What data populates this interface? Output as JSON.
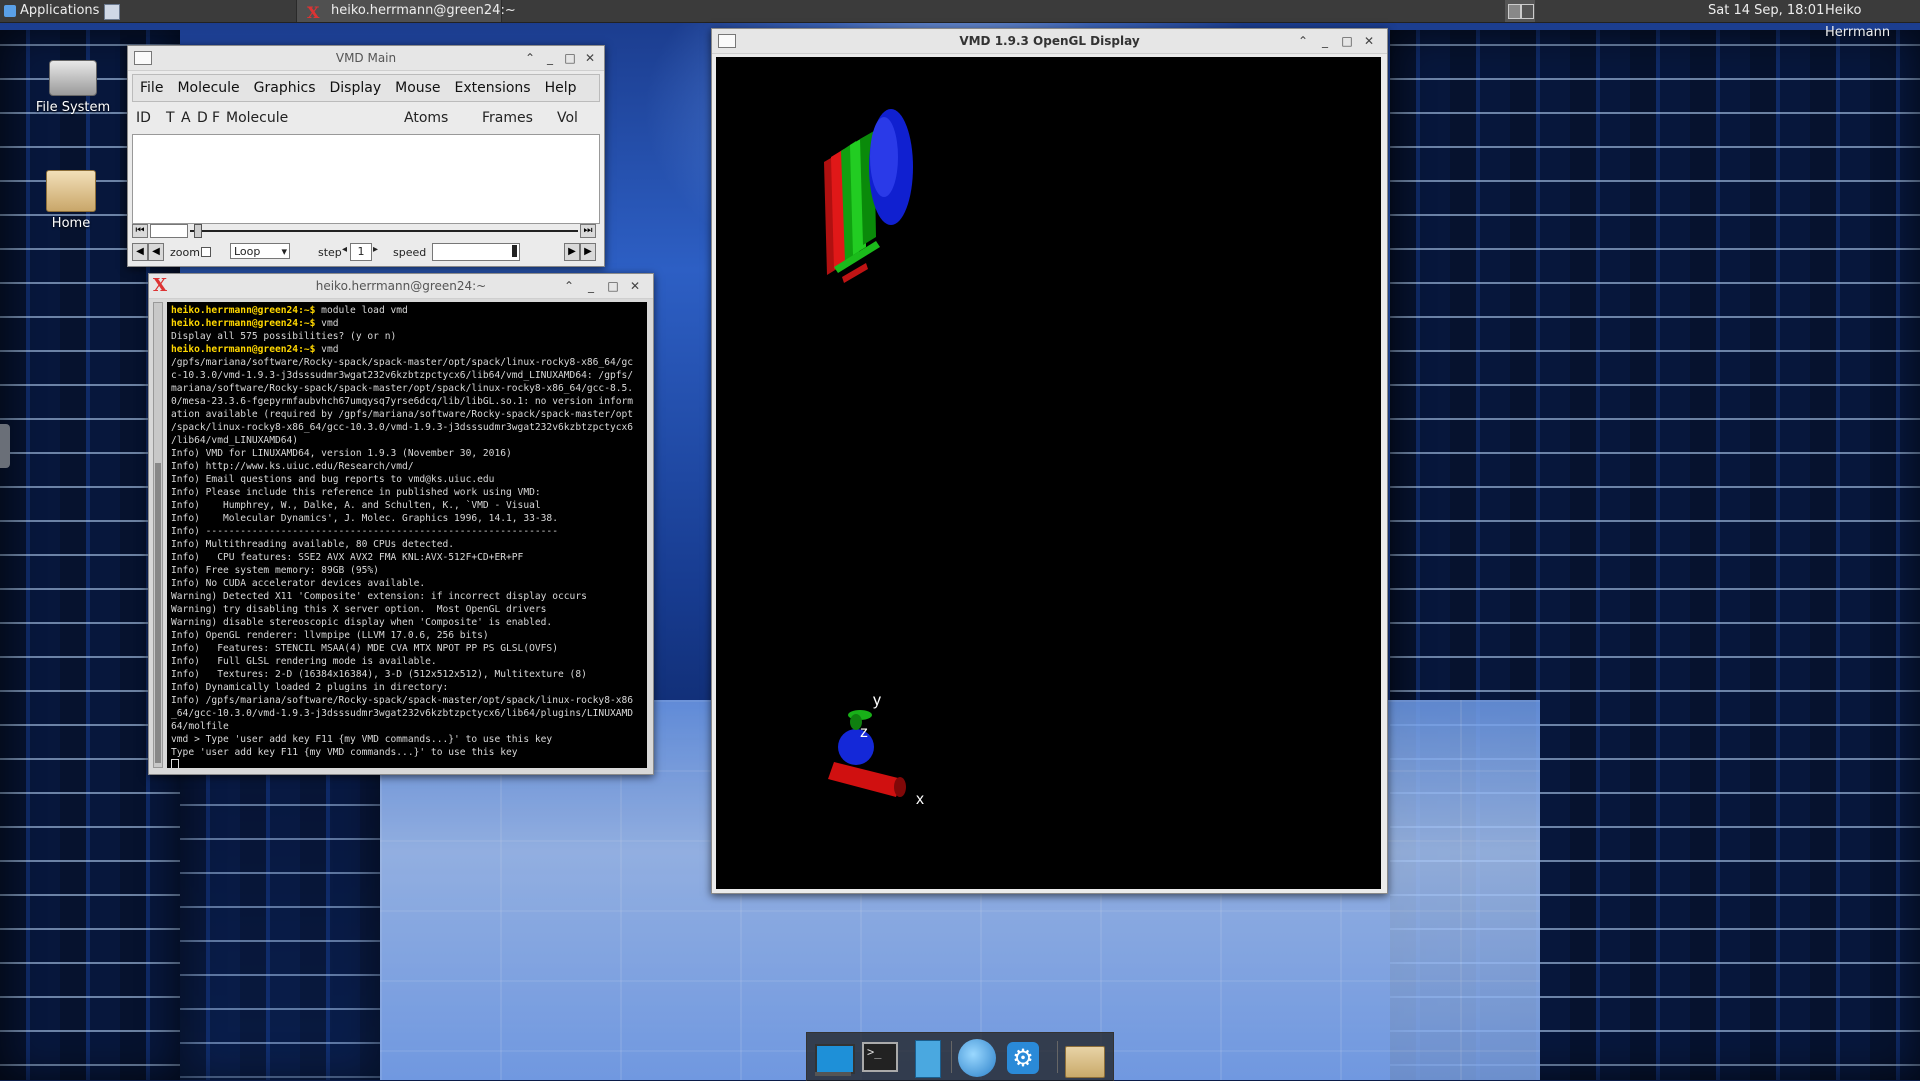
{
  "top_panel": {
    "applications_label": "Applications",
    "task_title": "heiko.herrmann@green24:~",
    "clock": "Sat 14 Sep, 18:01",
    "user": "Heiko Herrmann"
  },
  "desktop_icons": [
    {
      "label": "File System",
      "icon": "drive-icon"
    },
    {
      "label": "Home",
      "icon": "home-folder-icon"
    }
  ],
  "vmd_main": {
    "title": "VMD Main",
    "menu": [
      "File",
      "Molecule",
      "Graphics",
      "Display",
      "Mouse",
      "Extensions",
      "Help"
    ],
    "columns": {
      "id": "ID",
      "t": "T",
      "a": "A",
      "d": "D",
      "f": "F",
      "molecule": "Molecule",
      "atoms": "Atoms",
      "frames": "Frames",
      "vol": "Vol"
    },
    "controls": {
      "zoom_label": "zoom",
      "loop_value": "Loop",
      "step_label": "step",
      "step_value": "1",
      "speed_label": "speed"
    }
  },
  "terminal": {
    "title": "heiko.herrmann@green24:~",
    "prompt": "heiko.herrmann@green24:~$",
    "lines": [
      {
        "prompt": true,
        "text": " module load vmd"
      },
      {
        "prompt": true,
        "text": " vmd"
      },
      {
        "prompt": false,
        "text": "Display all 575 possibilities? (y or n)"
      },
      {
        "prompt": true,
        "text": " vmd"
      },
      {
        "prompt": false,
        "text": "/gpfs/mariana/software/Rocky-spack/spack-master/opt/spack/linux-rocky8-x86_64/gc"
      },
      {
        "prompt": false,
        "text": "c-10.3.0/vmd-1.9.3-j3dsssudmr3wgat232v6kzbtzpctycx6/lib64/vmd_LINUXAMD64: /gpfs/"
      },
      {
        "prompt": false,
        "text": "mariana/software/Rocky-spack/spack-master/opt/spack/linux-rocky8-x86_64/gcc-8.5."
      },
      {
        "prompt": false,
        "text": "0/mesa-23.3.6-fgepyrmfaubvhch67umqysq7yrse6dcq/lib/libGL.so.1: no version inform"
      },
      {
        "prompt": false,
        "text": "ation available (required by /gpfs/mariana/software/Rocky-spack/spack-master/opt"
      },
      {
        "prompt": false,
        "text": "/spack/linux-rocky8-x86_64/gcc-10.3.0/vmd-1.9.3-j3dsssudmr3wgat232v6kzbtzpctycx6"
      },
      {
        "prompt": false,
        "text": "/lib64/vmd_LINUXAMD64)"
      },
      {
        "prompt": false,
        "text": "Info) VMD for LINUXAMD64, version 1.9.3 (November 30, 2016)"
      },
      {
        "prompt": false,
        "text": "Info) http://www.ks.uiuc.edu/Research/vmd/"
      },
      {
        "prompt": false,
        "text": "Info) Email questions and bug reports to vmd@ks.uiuc.edu"
      },
      {
        "prompt": false,
        "text": "Info) Please include this reference in published work using VMD:"
      },
      {
        "prompt": false,
        "text": "Info)    Humphrey, W., Dalke, A. and Schulten, K., `VMD - Visual"
      },
      {
        "prompt": false,
        "text": "Info)    Molecular Dynamics', J. Molec. Graphics 1996, 14.1, 33-38."
      },
      {
        "prompt": false,
        "text": "Info) -------------------------------------------------------------"
      },
      {
        "prompt": false,
        "text": "Info) Multithreading available, 80 CPUs detected."
      },
      {
        "prompt": false,
        "text": "Info)   CPU features: SSE2 AVX AVX2 FMA KNL:AVX-512F+CD+ER+PF"
      },
      {
        "prompt": false,
        "text": "Info) Free system memory: 89GB (95%)"
      },
      {
        "prompt": false,
        "text": "Info) No CUDA accelerator devices available."
      },
      {
        "prompt": false,
        "text": "Warning) Detected X11 'Composite' extension: if incorrect display occurs"
      },
      {
        "prompt": false,
        "text": "Warning) try disabling this X server option.  Most OpenGL drivers"
      },
      {
        "prompt": false,
        "text": "Warning) disable stereoscopic display when 'Composite' is enabled."
      },
      {
        "prompt": false,
        "text": "Info) OpenGL renderer: llvmpipe (LLVM 17.0.6, 256 bits)"
      },
      {
        "prompt": false,
        "text": "Info)   Features: STENCIL MSAA(4) MDE CVA MTX NPOT PP PS GLSL(OVFS)"
      },
      {
        "prompt": false,
        "text": "Info)   Full GLSL rendering mode is available."
      },
      {
        "prompt": false,
        "text": "Info)   Textures: 2-D (16384x16384), 3-D (512x512x512), Multitexture (8)"
      },
      {
        "prompt": false,
        "text": "Info) Dynamically loaded 2 plugins in directory:"
      },
      {
        "prompt": false,
        "text": "Info) /gpfs/mariana/software/Rocky-spack/spack-master/opt/spack/linux-rocky8-x86"
      },
      {
        "prompt": false,
        "text": "_64/gcc-10.3.0/vmd-1.9.3-j3dsssudmr3wgat232v6kzbtzpctycx6/lib64/plugins/LINUXAMD"
      },
      {
        "prompt": false,
        "text": "64/molfile"
      },
      {
        "prompt": false,
        "text": "vmd > Type 'user add key F11 {my VMD commands...}' to use this key"
      },
      {
        "prompt": false,
        "text": "Type 'user add key F11 {my VMD commands...}' to use this key"
      }
    ]
  },
  "gl_window": {
    "title": "VMD 1.9.3 OpenGL Display",
    "axis_labels": {
      "x": "x",
      "y": "y",
      "z": "z"
    }
  },
  "dock": [
    {
      "name": "show-desktop-icon"
    },
    {
      "name": "terminal-icon"
    },
    {
      "name": "file-manager-icon"
    },
    {
      "name": "web-browser-icon"
    },
    {
      "name": "settings-icon"
    },
    {
      "name": "folder-icon"
    }
  ],
  "colors": {
    "panel": "#3b3b3b",
    "prompt": "#ffd700",
    "axis_x": "#e01010",
    "axis_y": "#10a010",
    "axis_z": "#1020d0"
  }
}
